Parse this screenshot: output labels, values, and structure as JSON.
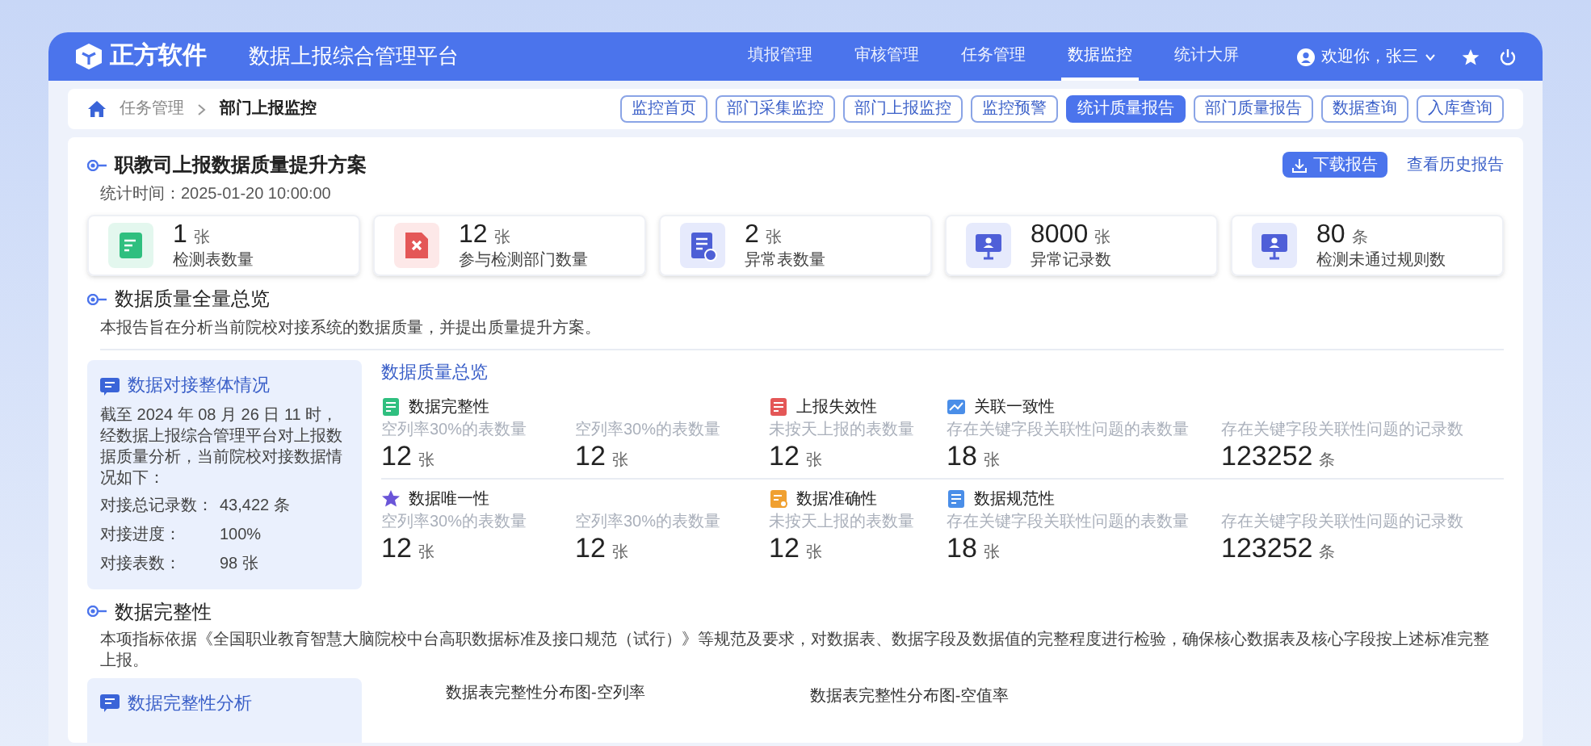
{
  "header": {
    "logo": "正方软件",
    "title": "数据上报综合管理平台",
    "nav": [
      {
        "label": "填报管理",
        "selected": false
      },
      {
        "label": "审核管理",
        "selected": false
      },
      {
        "label": "任务管理",
        "selected": false
      },
      {
        "label": "数据监控",
        "selected": true
      },
      {
        "label": "统计大屏",
        "selected": false
      }
    ],
    "user": "欢迎你，张三"
  },
  "breadcrumb": [
    "任务管理",
    "部门上报监控"
  ],
  "tabs": [
    {
      "label": "监控首页",
      "selected": false
    },
    {
      "label": "部门采集监控",
      "selected": false
    },
    {
      "label": "部门上报监控",
      "selected": false
    },
    {
      "label": "监控预警",
      "selected": false
    },
    {
      "label": "统计质量报告",
      "selected": true
    },
    {
      "label": "部门质量报告",
      "selected": false
    },
    {
      "label": "数据查询",
      "selected": false
    },
    {
      "label": "入库查询",
      "selected": false
    }
  ],
  "report": {
    "title": "职教司上报数据质量提升方案",
    "time": "统计时间：2025-01-20  10:00:00",
    "download": "下载报告",
    "history": "查看历史报告",
    "stats": [
      {
        "kind": "form",
        "value": "1",
        "unit": "张",
        "label": "检测表数量"
      },
      {
        "kind": "error",
        "value": "12",
        "unit": "张",
        "label": "参与检测部门数量"
      },
      {
        "kind": "doc",
        "value": "2",
        "unit": "张",
        "label": "异常表数量"
      },
      {
        "kind": "monitor",
        "value": "8000",
        "unit": "张",
        "label": "异常记录数"
      },
      {
        "kind": "monitor",
        "value": "80",
        "unit": "条",
        "label": "检测未通过规则数"
      }
    ]
  },
  "overview": {
    "title": "数据质量全量总览",
    "desc": "本报告旨在分析当前院校对接系统的数据质量，并提出质量提升方案。",
    "summary": {
      "title": "数据对接整体情况",
      "text": "截至 2024 年 08 月 26 日 11 时，经数据上报综合管理平台对上报数据质量分析，当前院校对接数据情况如下：",
      "rows": [
        {
          "label": "对接总记录数：",
          "value": "43,422 条"
        },
        {
          "label": "对接进度：",
          "value": "100%"
        },
        {
          "label": "对接表数：",
          "value": "98 张"
        }
      ]
    },
    "quality": {
      "title": "数据质量总览",
      "rows": [
        {
          "groups": [
            {
              "kind": "complete",
              "title": "数据完整性",
              "metrics": [
                {
                  "label": "空列率30%的表数量",
                  "value": "12",
                  "unit": "张"
                },
                {
                  "label": "空列率30%的表数量",
                  "value": "12",
                  "unit": "张"
                }
              ]
            },
            {
              "kind": "expired",
              "title": "上报失效性",
              "metrics": [
                {
                  "label": "未按天上报的表数量",
                  "value": "12",
                  "unit": "张"
                }
              ]
            },
            {
              "kind": "linked",
              "title": "关联一致性",
              "metrics": [
                {
                  "label": "存在关键字段关联性问题的表数量",
                  "value": "18",
                  "unit": "张"
                },
                {
                  "label": "存在关键字段关联性问题的记录数",
                  "value": "123252",
                  "unit": "条"
                }
              ]
            }
          ]
        },
        {
          "groups": [
            {
              "kind": "unique",
              "title": "数据唯一性",
              "metrics": [
                {
                  "label": "空列率30%的表数量",
                  "value": "12",
                  "unit": "张"
                },
                {
                  "label": "空列率30%的表数量",
                  "value": "12",
                  "unit": "张"
                }
              ]
            },
            {
              "kind": "accurate",
              "title": "数据准确性",
              "metrics": [
                {
                  "label": "未按天上报的表数量",
                  "value": "12",
                  "unit": "张"
                }
              ]
            },
            {
              "kind": "standard",
              "title": "数据规范性",
              "metrics": [
                {
                  "label": "存在关键字段关联性问题的表数量",
                  "value": "18",
                  "unit": "张"
                },
                {
                  "label": "存在关键字段关联性问题的记录数",
                  "value": "123252",
                  "unit": "条"
                }
              ]
            }
          ]
        }
      ]
    }
  },
  "completeness": {
    "title": "数据完整性",
    "desc": "本项指标依据《全国职业教育智慧大脑院校中台高职数据标准及接口规范（试行）》等规范及要求，对数据表、数据字段及数据值的完整程度进行检验，确保核心数据表及核心字段按上述标准完整上报。",
    "panel_title": "数据完整性分析",
    "charts": [
      "数据表完整性分布图-空列率",
      "数据表完整性分布图-空值率"
    ]
  }
}
